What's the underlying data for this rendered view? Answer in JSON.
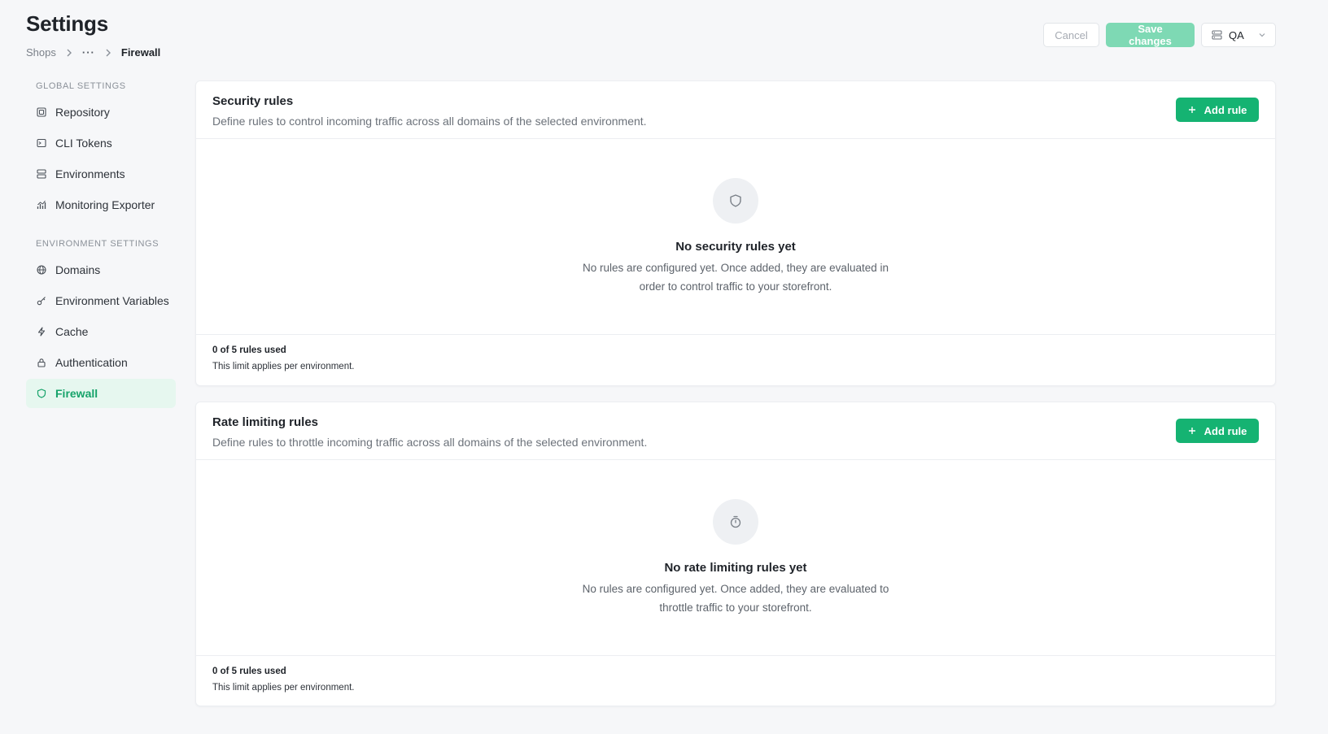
{
  "page": {
    "title": "Settings",
    "breadcrumb": {
      "first": "Shops",
      "ellipsis": "···",
      "current": "Firewall"
    }
  },
  "toolbar": {
    "cancel_label": "Cancel",
    "save_label": "Save changes",
    "environment": "QA"
  },
  "sidebar": {
    "global_heading": "GLOBAL SETTINGS",
    "global_items": [
      {
        "label": "Repository",
        "icon": "repository-icon"
      },
      {
        "label": "CLI Tokens",
        "icon": "terminal-icon"
      },
      {
        "label": "Environments",
        "icon": "server-icon"
      },
      {
        "label": "Monitoring Exporter",
        "icon": "chart-icon"
      }
    ],
    "env_heading": "ENVIRONMENT SETTINGS",
    "env_items": [
      {
        "label": "Domains",
        "icon": "globe-icon"
      },
      {
        "label": "Environment Variables",
        "icon": "key-icon"
      },
      {
        "label": "Cache",
        "icon": "lightning-icon"
      },
      {
        "label": "Authentication",
        "icon": "lock-icon"
      },
      {
        "label": "Firewall",
        "icon": "shield-icon",
        "active": true
      }
    ]
  },
  "security_rules": {
    "title": "Security rules",
    "description": "Define rules to control incoming traffic across all domains of the selected environment.",
    "add_label": "Add rule",
    "empty_title": "No security rules yet",
    "empty_text": "No rules are configured yet. Once added, they are evaluated in order to control traffic to your storefront.",
    "usage": "0 of 5 rules used",
    "usage_note": "This limit applies per environment."
  },
  "rate_limiting_rules": {
    "title": "Rate limiting rules",
    "description": "Define rules to throttle incoming traffic across all domains of the selected environment.",
    "add_label": "Add rule",
    "empty_title": "No rate limiting rules yet",
    "empty_text": "No rules are configured yet. Once added, they are evaluated to throttle traffic to your storefront.",
    "usage": "0 of 5 rules used",
    "usage_note": "This limit applies per environment."
  },
  "colors": {
    "accent": "#15b372",
    "accent_disabled": "#7ed9b4",
    "active_bg": "#e6f7ef"
  }
}
